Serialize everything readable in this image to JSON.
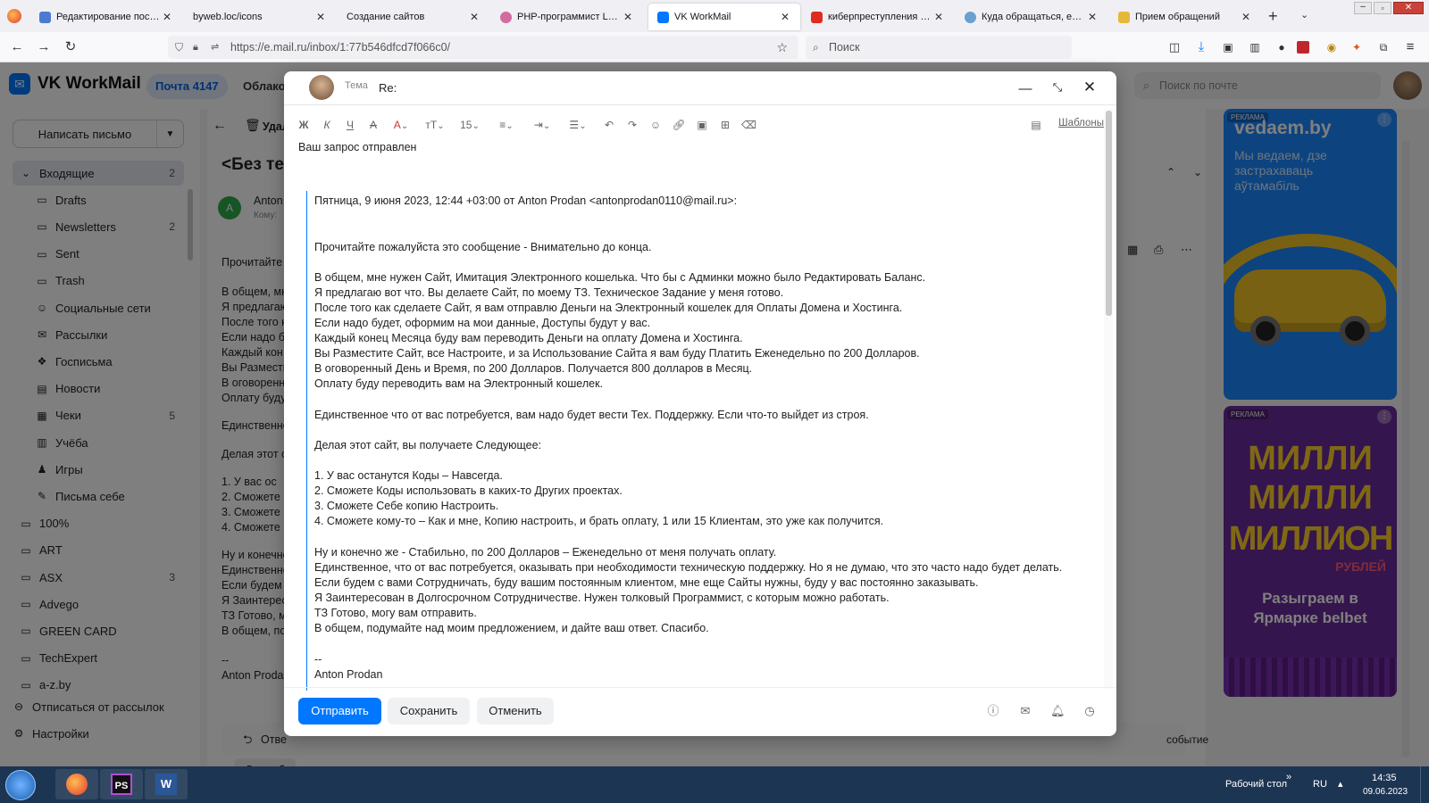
{
  "browser": {
    "tabs": [
      {
        "title": "Редактирование постов",
        "color": "#4a7bd0"
      },
      {
        "title": "byweb.loc/icons",
        "color": "#9aa0a6"
      },
      {
        "title": "Создание сайтов",
        "color": "#9aa0a6"
      },
      {
        "title": "PHP-программист Laravel",
        "color": "#d36b9f"
      },
      {
        "title": "VK WorkMail",
        "color": "#0077ff"
      },
      {
        "title": "киберпреступления пожал",
        "color": "#e02b20"
      },
      {
        "title": "Куда обращаться, если сто",
        "color": "#6b9fcf"
      },
      {
        "title": "Прием обращений",
        "color": "#e5b73b"
      }
    ],
    "url": "https://e.mail.ru/inbox/1:77b546dfcd7f066c0/",
    "search_placeholder": "Поиск"
  },
  "app": {
    "logo": "VK WorkMail",
    "mail_pill": "Почта 4147",
    "cloud": "Облако",
    "search_placeholder": "Поиск по почте"
  },
  "sidebar": {
    "compose": "Написать письмо",
    "folders": [
      {
        "label": "Входящие",
        "count": "2",
        "icon": "chevron-down-icon"
      },
      {
        "label": "Drafts",
        "count": "",
        "icon": "folder-icon"
      },
      {
        "label": "Newsletters",
        "count": "2",
        "icon": "folder-icon"
      },
      {
        "label": "Sent",
        "count": "",
        "icon": "folder-icon"
      },
      {
        "label": "Trash",
        "count": "",
        "icon": "folder-icon"
      },
      {
        "label": "Социальные сети",
        "count": "",
        "icon": "people-icon"
      },
      {
        "label": "Рассылки",
        "count": "",
        "icon": "newsletter-icon"
      },
      {
        "label": "Госписьма",
        "count": "",
        "icon": "emblem-icon"
      },
      {
        "label": "Новости",
        "count": "",
        "icon": "news-icon"
      },
      {
        "label": "Чеки",
        "count": "5",
        "icon": "receipt-icon"
      },
      {
        "label": "Учёба",
        "count": "",
        "icon": "study-icon"
      },
      {
        "label": "Игры",
        "count": "",
        "icon": "game-icon"
      },
      {
        "label": "Письма себе",
        "count": "",
        "icon": "self-mail-icon"
      },
      {
        "label": "100%",
        "count": "",
        "icon": "folder-icon"
      },
      {
        "label": "ART",
        "count": "",
        "icon": "folder-icon"
      },
      {
        "label": "ASX",
        "count": "3",
        "icon": "folder-icon"
      },
      {
        "label": "Advego",
        "count": "",
        "icon": "folder-icon"
      },
      {
        "label": "GREEN CARD",
        "count": "",
        "icon": "folder-icon"
      },
      {
        "label": "TechExpert",
        "count": "",
        "icon": "folder-icon"
      },
      {
        "label": "a-z.by",
        "count": "",
        "icon": "folder-icon"
      }
    ],
    "unsubscribe": "Отписаться от рассылок",
    "settings": "Настройки"
  },
  "background_mail": {
    "delete_label": "Удал",
    "subject": "<Без тем",
    "sender": "Anton",
    "to_label": "Кому:",
    "avatar_letter": "A",
    "lines": [
      "Прочитайте",
      "В общем, мн",
      "Я предлагаю",
      "После того к",
      "Если надо бу",
      " Каждый кон",
      "Вы Разместит",
      "В оговоренны",
      "Оплату буду",
      "Единственно",
      "Делая этот с",
      "1.   У вас ос",
      "2.   Сможете",
      "3.   Сможете",
      "4.   Сможете",
      "Ну и конечно",
      "Единственно",
      "Если будем",
      "Я Заинтересо",
      "ТЗ Готово, м",
      "В общем, по",
      "--",
      "Anton Prodan"
    ],
    "reply_label": "Отве",
    "thanks_label": "Спасиб",
    "event_label": "событие"
  },
  "ads": {
    "tag": "РЕКЛАМА",
    "ad1_brand": "vedaem.by",
    "ad1_text": "Мы ведаем, дзе застрахаваць аўтамабіль",
    "ad2_line1": "МИЛЛИ",
    "ad2_line2": "МИЛЛИ",
    "ad2_line3": "МИЛЛИОН",
    "ad2_sub": "РУБЛЕЙ",
    "ad2_text": "Разыграем в Ярмарке belbet"
  },
  "compose": {
    "subject_label": "Тема",
    "subject_value": "Re:",
    "templates": "Шаблоны",
    "font_size": "15",
    "message": "Ваш запрос отправлен",
    "quote_header": "Пятница, 9 июня 2023, 12:44 +03:00 от Anton Prodan <antonprodan0110@mail.ru>:",
    "quote_lines": [
      "Прочитайте пожалуйста это сообщение - Внимательно до конца.",
      "В общем, мне нужен Сайт, Имитация Электронного кошелька. Что бы с Админки можно было Редактировать Баланс.",
      "Я предлагаю вот что. Вы делаете Сайт, по моему ТЗ. Техническое Задание у меня готово.",
      "После того как сделаете Сайт, я вам отправлю Деньги на Электронный кошелек для Оплаты Домена и Хостинга.",
      "Если надо будет, оформим на мои данные, Доступы будут у вас.",
      " Каждый конец Месяца буду вам переводить Деньги на оплату Домена и Хостинга.",
      "Вы Разместите Сайт, все Настроите, и за Использование Сайта я вам буду Платить Еженедельно по 200 Долларов.",
      "В оговоренный День и Время, по 200 Долларов. Получается 800 долларов в Месяц.",
      "Оплату буду переводить вам на Электронный кошелек.",
      "Единственное что от вас потребуется, вам надо будет вести Тех. Поддержку. Если что-то выйдет из строя.",
      "Делая этот сайт, вы получаете Следующее:",
      "1.    У вас останутся Коды – Навсегда.",
      "2.    Сможете Коды использовать в каких-то Других проектах.",
      "3.    Сможете Себе копию Настроить.",
      "4.    Сможете кому-то – Как и мне, Копию настроить, и брать оплату, 1 или 15 Клиентам, это уже как получится.",
      "Ну и конечно же - Стабильно, по 200 Долларов – Еженедельно от меня получать оплату.",
      "Единственное, что от вас потребуется, оказывать при необходимости техническую поддержку. Но я не думаю, что это часто надо будет делать.",
      "Если будем с вами Сотрудничать, буду вашим постоянным клиентом, мне еще Сайты нужны, буду у вас постоянно заказывать.",
      "Я Заинтересован в Долгосрочном Сотрудничестве. Нужен толковый Программист, с которым можно работать.",
      "ТЗ Готово, могу вам отправить.",
      "В общем, подумайте над моим предложением, и дайте ваш ответ. Спасибо.",
      "--",
      "Anton Prodan"
    ],
    "send": "Отправить",
    "save": "Сохранить",
    "cancel": "Отменить"
  },
  "taskbar": {
    "desktop": "Рабочий стол",
    "lang": "RU",
    "time": "14:35",
    "date": "09.06.2023"
  },
  "colors": {
    "accent": "#0077ff",
    "taskbar": "#1c3552"
  }
}
